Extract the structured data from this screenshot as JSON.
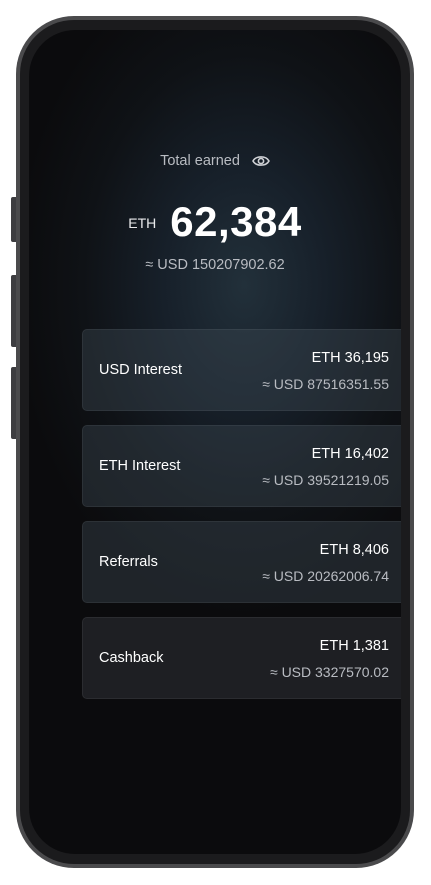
{
  "total": {
    "label": "Total earned",
    "currency": "ETH",
    "amount": "62,384",
    "usd": "≈ USD 150207902.62"
  },
  "breakdown": [
    {
      "label": "USD Interest",
      "primary": "ETH 36,195",
      "secondary": "≈ USD 87516351.55"
    },
    {
      "label": "ETH Interest",
      "primary": "ETH 16,402",
      "secondary": "≈ USD 39521219.05"
    },
    {
      "label": "Referrals",
      "primary": "ETH 8,406",
      "secondary": "≈ USD 20262006.74"
    },
    {
      "label": "Cashback",
      "primary": "ETH 1,381",
      "secondary": "≈ USD 3327570.02"
    }
  ],
  "icons": {
    "visibility_toggle": "eye-icon"
  }
}
